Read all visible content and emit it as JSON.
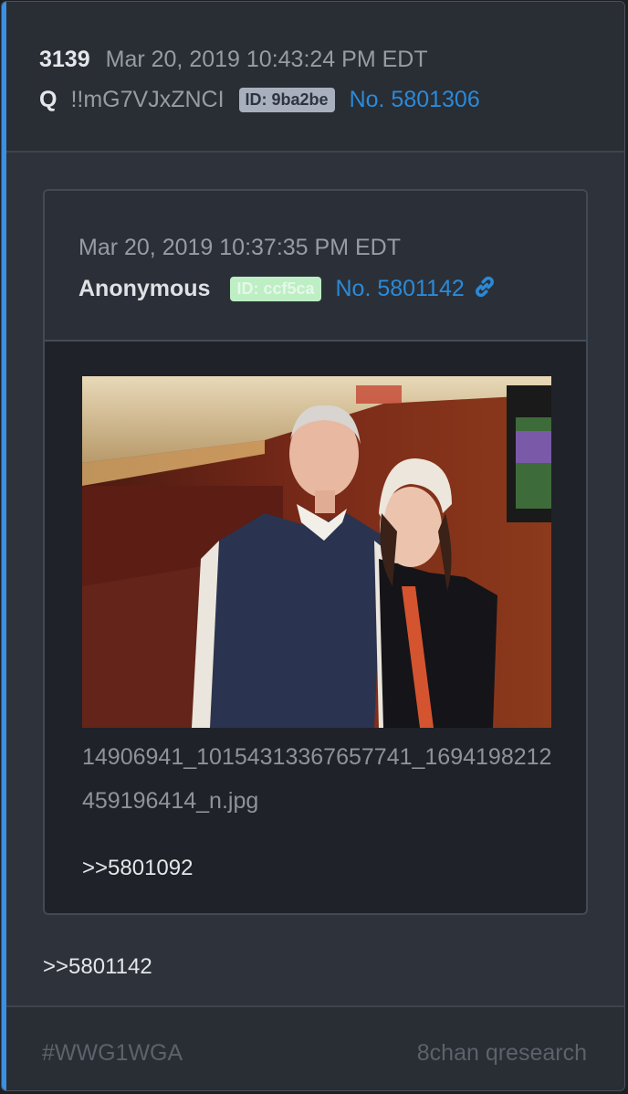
{
  "post": {
    "number": "3139",
    "date": "Mar 20, 2019 10:43:24 PM EDT",
    "name": "Q",
    "tripcode": "!!mG7VJxZNCI",
    "id_badge": "ID: 9ba2be",
    "post_no": "No. 5801306",
    "body_quote": ">>5801142"
  },
  "quoted_post": {
    "date": "Mar 20, 2019 10:37:35 PM EDT",
    "name": "Anonymous",
    "id_badge": "ID: ccf5ca",
    "post_no": "No. 5801142",
    "link_icon": "link-icon",
    "image_filename": "14906941_10154313367657741_1694198212459196414_n.jpg",
    "body_quote": ">>5801092"
  },
  "footer": {
    "hashtag": "#WWG1WGA",
    "board": "8chan qresearch"
  },
  "colors": {
    "accent": "#3d8fe0",
    "link": "#2a8ad9",
    "id_gray": "#a9b0bd",
    "id_green": "#bdeec4"
  }
}
